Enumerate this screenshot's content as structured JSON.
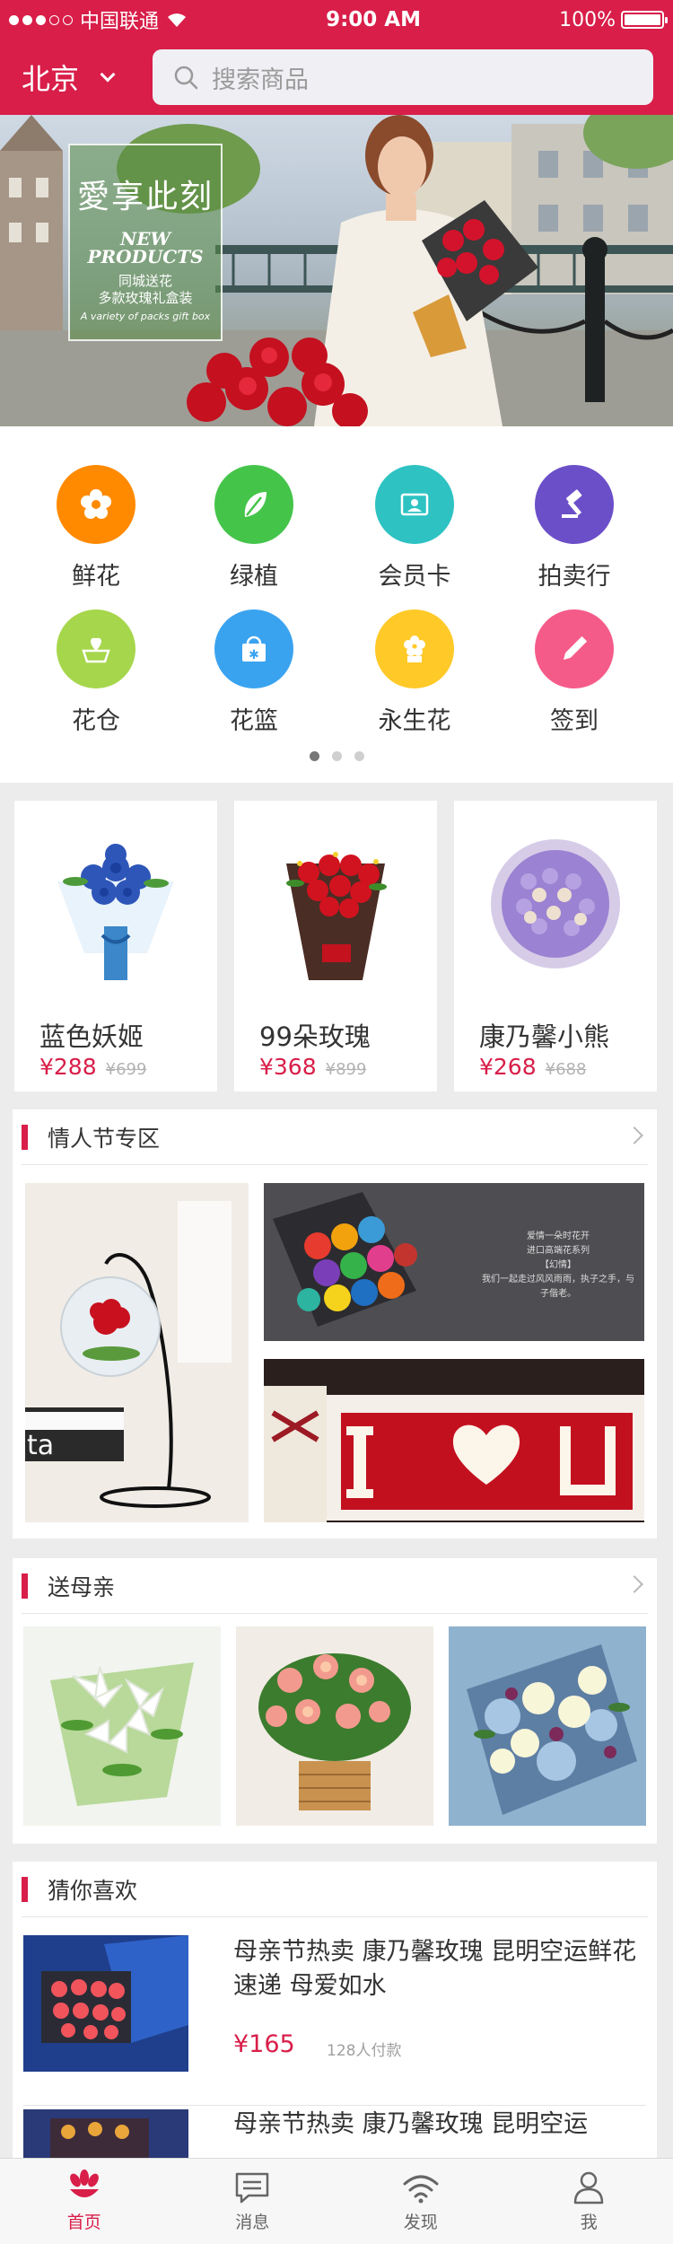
{
  "status_bar": {
    "carrier": "中国联通",
    "time": "9:00 AM",
    "battery": "100%"
  },
  "header": {
    "city": "北京",
    "search_placeholder": "搜索商品"
  },
  "banner": {
    "headline": "愛享此刻",
    "line1": "NEW",
    "line2": "PRODUCTS",
    "line3": "同城送花",
    "line4": "多款玫瑰礼盒装",
    "line5": "A variety of packs gift box"
  },
  "categories": [
    {
      "label": "鲜花",
      "icon": "flower-icon",
      "color": "#ff8a00"
    },
    {
      "label": "绿植",
      "icon": "leaf-icon",
      "color": "#45c44a"
    },
    {
      "label": "会员卡",
      "icon": "member-card-icon",
      "color": "#2ec2c2"
    },
    {
      "label": "拍卖行",
      "icon": "auction-gavel-icon",
      "color": "#6b4fc8"
    },
    {
      "label": "花仓",
      "icon": "flower-warehouse-icon",
      "color": "#a6d64b"
    },
    {
      "label": "花篮",
      "icon": "flower-basket-icon",
      "color": "#3aa3f0"
    },
    {
      "label": "永生花",
      "icon": "preserved-flower-icon",
      "color": "#ffc928"
    },
    {
      "label": "签到",
      "icon": "pencil-sign-in-icon",
      "color": "#f55b89"
    }
  ],
  "pager": {
    "pages": 3,
    "current": 1
  },
  "products": [
    {
      "name": "蓝色妖姬",
      "price": "¥288",
      "old_price": "¥699"
    },
    {
      "name": "99朵玫瑰",
      "price": "¥368",
      "old_price": "¥899"
    },
    {
      "name": "康乃馨小熊",
      "price": "¥268",
      "old_price": "¥688"
    }
  ],
  "valentine": {
    "title": "情人节专区",
    "box_text": {
      "l1": "爱情一朵时花开",
      "l2": "进口高端花系列",
      "l3": "【幻情】",
      "l4": "我们一起走过风风雨雨，执子之手，与子偕老。"
    },
    "decor_text": "ta"
  },
  "mother": {
    "title": "送母亲"
  },
  "guess": {
    "title": "猜你喜欢",
    "items": [
      {
        "title": "母亲节热卖 康乃馨玫瑰 昆明空运鲜花速递 母爱如水",
        "price": "¥165",
        "sold": "128人付款"
      },
      {
        "title": "母亲节热卖 康乃馨玫瑰 昆明空运",
        "price": "",
        "sold": ""
      }
    ]
  },
  "tabbar": [
    {
      "label": "首页",
      "icon": "home-flower-icon",
      "active": true
    },
    {
      "label": "消息",
      "icon": "message-icon",
      "active": false
    },
    {
      "label": "发现",
      "icon": "discover-wifi-icon",
      "active": false
    },
    {
      "label": "我",
      "icon": "profile-icon",
      "active": false
    }
  ],
  "colors": {
    "brand": "#d81e49",
    "background": "#ececec"
  }
}
